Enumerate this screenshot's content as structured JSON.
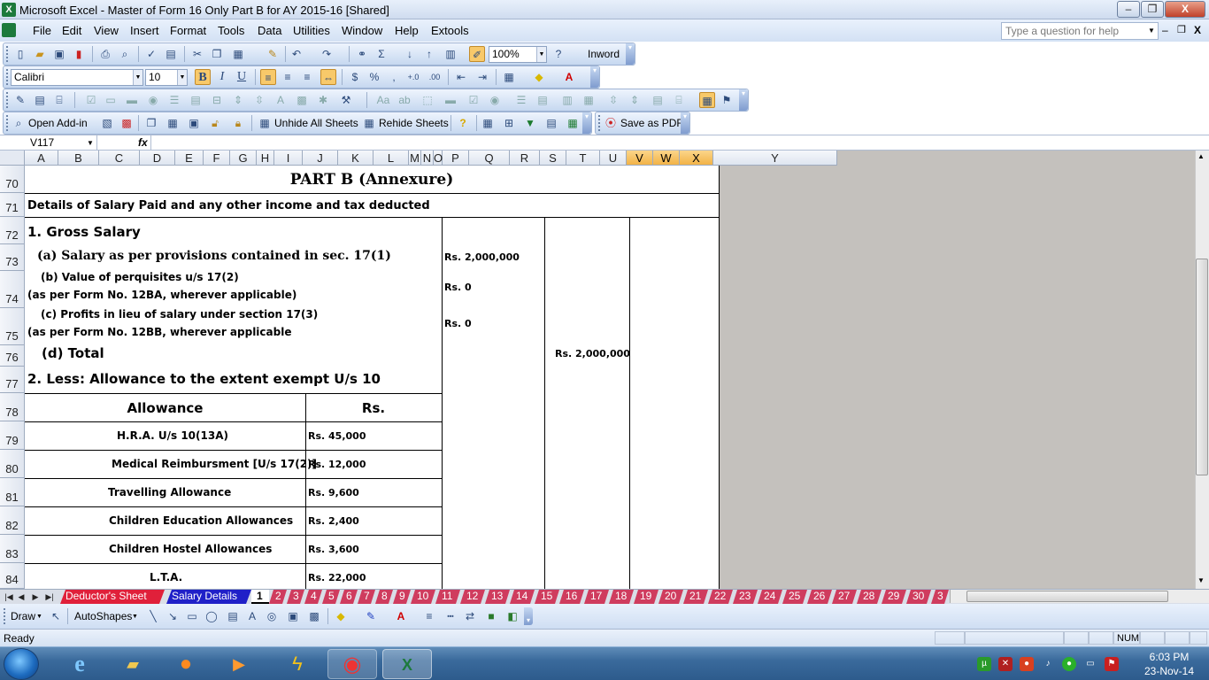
{
  "window": {
    "title": "Microsoft Excel - Master of Form 16 Only Part  B for AY 2015-16  [Shared]",
    "icon": "excel-icon"
  },
  "window_buttons": {
    "minimize": "–",
    "restore": "❐",
    "close": "X",
    "doc_min": "–",
    "doc_restore": "❐",
    "doc_close": "X"
  },
  "menu": [
    "File",
    "Edit",
    "View",
    "Insert",
    "Format",
    "Tools",
    "Data",
    "Utilities",
    "Window",
    "Help",
    "Extools"
  ],
  "help_box": {
    "placeholder": "Type a question for help"
  },
  "standard_toolbar": {
    "zoom": "100%",
    "inword_label": "Inword"
  },
  "formatting_toolbar": {
    "font": "Calibri",
    "size": "10",
    "bold": "B",
    "italic": "I",
    "underline": "U"
  },
  "addins_toolbar": {
    "open_addin": "Open Add-in",
    "unhide_all": "Unhide All Sheets",
    "rehide": "Rehide Sheets",
    "save_pdf": "Save as PDF"
  },
  "formula_bar": {
    "name_box": "V117",
    "fx": "fx",
    "content": ""
  },
  "columns": [
    "A",
    "B",
    "C",
    "D",
    "E",
    "F",
    "G",
    "H",
    "I",
    "J",
    "K",
    "L",
    "M",
    "N",
    "O",
    "P",
    "Q",
    "R",
    "S",
    "T",
    "U",
    "V",
    "W",
    "X",
    "Y"
  ],
  "rows": [
    "70",
    "71",
    "72",
    "73",
    "74",
    "75",
    "76",
    "77",
    "78",
    "79",
    "80",
    "81",
    "82",
    "83",
    "84"
  ],
  "sheet": {
    "title": "PART B (Annexure)",
    "subtitle": "Details of Salary Paid and any other income and tax deducted",
    "gross_salary": "1.  Gross Salary",
    "item_a": "(a) Salary as per provisions contained in sec. 17(1)",
    "item_a_value": "Rs. 2,000,000",
    "item_b": "(b) Value of perquisites u/s 17(2)",
    "item_b_note": "(as per Form No. 12BA, wherever applicable)",
    "item_b_value": "Rs. 0",
    "item_c": "(c) Profits in lieu of salary under section 17(3)",
    "item_c_note": "(as per Form No. 12BB, wherever applicable",
    "item_c_value": "Rs. 0",
    "item_d": "(d) Total",
    "item_d_value": "Rs. 2,000,000",
    "less_allowance": "2. Less: Allowance to the extent exempt U/s 10",
    "table_header": {
      "allowance": "Allowance",
      "rs": "Rs."
    },
    "allowances": [
      {
        "name": "H.R.A. U/s 10(13A)",
        "value": "Rs. 45,000"
      },
      {
        "name": "Medical Reimbursment [U/s 17(2)]",
        "value": "Rs. 12,000"
      },
      {
        "name": "Travelling Allowance",
        "value": "Rs. 9,600"
      },
      {
        "name": "Children Education Allowances",
        "value": "Rs. 2,400"
      },
      {
        "name": "Children Hostel Allowances",
        "value": "Rs. 3,600"
      },
      {
        "name": "L.T.A.",
        "value": "Rs. 22,000"
      }
    ]
  },
  "sheet_tabs": {
    "deductor": "Deductor's Sheet",
    "salary": "Salary Details",
    "numbers": [
      "1",
      "2",
      "3",
      "4",
      "5",
      "6",
      "7",
      "8",
      "9",
      "10",
      "11",
      "12",
      "13",
      "14",
      "15",
      "16",
      "17",
      "18",
      "19",
      "20",
      "21",
      "22",
      "23",
      "24",
      "25",
      "26",
      "27",
      "28",
      "29",
      "30",
      "3"
    ]
  },
  "draw_toolbar": {
    "draw": "Draw",
    "autoshapes": "AutoShapes"
  },
  "status": {
    "text": "Ready",
    "num": "NUM"
  },
  "taskbar": {
    "time": "6:03 PM",
    "date": "23-Nov-14"
  },
  "colors": {
    "selected_col": "#f2b347",
    "sheet_tab_red": "#e0203a",
    "sheet_tab_blue": "#2020c8",
    "grey_area": "#c4c1bd"
  }
}
